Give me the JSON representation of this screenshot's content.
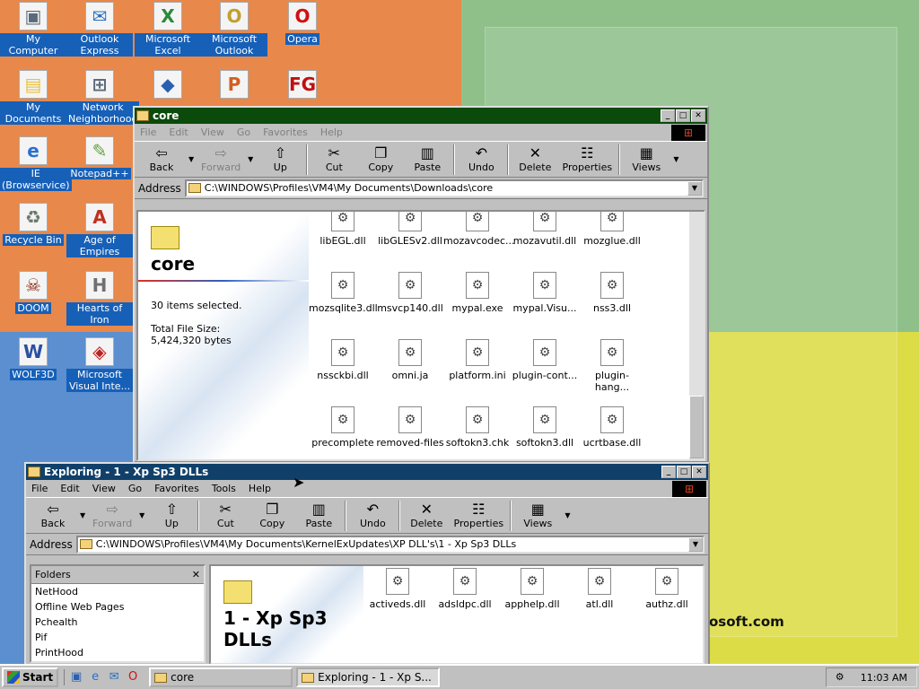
{
  "desktop": {
    "icons": [
      {
        "label": "My Computer",
        "glyph": "▣",
        "color": "#5a6a7a"
      },
      {
        "label": "Outlook Express",
        "glyph": "✉",
        "color": "#2a70c0"
      },
      {
        "label": "Microsoft Excel",
        "glyph": "X",
        "color": "#2a8a3a"
      },
      {
        "label": "Microsoft Outlook",
        "glyph": "O",
        "color": "#c0a030"
      },
      {
        "label": "Opera",
        "glyph": "O",
        "color": "#d01010"
      },
      {
        "label": "My Documents",
        "glyph": "▤",
        "color": "#e8c040"
      },
      {
        "label": "Network Neighborhood",
        "glyph": "⊞",
        "color": "#5a6a7a"
      },
      {
        "label": "",
        "glyph": "◆",
        "color": "#2a60b0"
      },
      {
        "label": "",
        "glyph": "P",
        "color": "#d06020"
      },
      {
        "label": "",
        "glyph": "FG",
        "color": "#c01010"
      },
      {
        "label": "IE (Browservice)",
        "glyph": "e",
        "color": "#2a70d0"
      },
      {
        "label": "Notepad++",
        "glyph": "✎",
        "color": "#60a040"
      },
      {
        "label": "Recycle Bin",
        "glyph": "♻",
        "color": "#6a7a6a"
      },
      {
        "label": "Age of Empires",
        "glyph": "A",
        "color": "#c03020"
      },
      {
        "label": "DOOM",
        "glyph": "☠",
        "color": "#8a2a10"
      },
      {
        "label": "Hearts of Iron",
        "glyph": "H",
        "color": "#707070"
      },
      {
        "label": "WOLF3D",
        "glyph": "W",
        "color": "#2a50a0"
      },
      {
        "label": "Microsoft Visual Inte...",
        "glyph": "◈",
        "color": "#c02020"
      }
    ],
    "brand_text": "osoft.com"
  },
  "core_window": {
    "title": "core",
    "title_color": "#0a4a0a",
    "menu": [
      "File",
      "Edit",
      "View",
      "Go",
      "Favorites",
      "Help"
    ],
    "toolbar": {
      "back": "Back",
      "forward": "Forward",
      "up": "Up",
      "cut": "Cut",
      "copy": "Copy",
      "paste": "Paste",
      "undo": "Undo",
      "delete": "Delete",
      "properties": "Properties",
      "views": "Views"
    },
    "address_label": "Address",
    "address": "C:\\WINDOWS\\Profiles\\VM4\\My Documents\\Downloads\\core",
    "info_title": "core",
    "selected_text": "30 items selected.",
    "size_label": "Total File Size:",
    "size_value": "5,424,320 bytes",
    "files": [
      "libEGL.dll",
      "libGLESv2.dll",
      "mozavcodec...",
      "mozavutil.dll",
      "mozglue.dll",
      "mozsqlite3.dll",
      "msvcp140.dll",
      "mypal.exe",
      "mypal.Visu...",
      "nss3.dll",
      "nssckbi.dll",
      "omni.ja",
      "platform.ini",
      "plugin-cont...",
      "plugin-hang...",
      "precomplete",
      "removed-files",
      "softokn3.chk",
      "softokn3.dll",
      "ucrtbase.dll"
    ]
  },
  "exploring_window": {
    "title": "Exploring - 1 - Xp Sp3 DLLs",
    "title_color": "#10406a",
    "menu": [
      "File",
      "Edit",
      "View",
      "Go",
      "Favorites",
      "Tools",
      "Help"
    ],
    "toolbar": {
      "back": "Back",
      "forward": "Forward",
      "up": "Up",
      "cut": "Cut",
      "copy": "Copy",
      "paste": "Paste",
      "undo": "Undo",
      "delete": "Delete",
      "properties": "Properties",
      "views": "Views"
    },
    "address_label": "Address",
    "address": "C:\\WINDOWS\\Profiles\\VM4\\My Documents\\KernelExUpdates\\XP DLL's\\1 - Xp Sp3 DLLs",
    "folders_title": "Folders",
    "folders": [
      "NetHood",
      "Offline Web Pages",
      "Pchealth",
      "Pif",
      "PrintHood"
    ],
    "info_title": "1 - Xp Sp3 DLLs",
    "files": [
      "activeds.dll",
      "adsldpc.dll",
      "apphelp.dll",
      "atl.dll",
      "authz.dll"
    ]
  },
  "taskbar": {
    "start": "Start",
    "tasks": [
      "core",
      "Exploring - 1 - Xp S..."
    ],
    "clock": "11:03 AM"
  }
}
